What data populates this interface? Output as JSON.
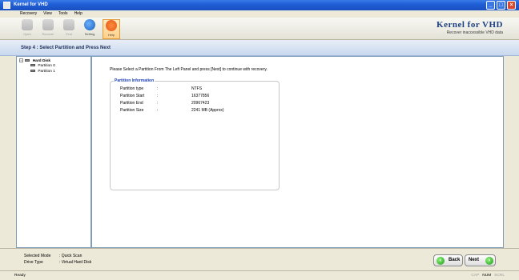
{
  "window": {
    "title": "Kernel for VHD",
    "buttons": [
      "_",
      "□",
      "×"
    ]
  },
  "menu": [
    "Recovery",
    "View",
    "Tools",
    "Help"
  ],
  "toolbar": {
    "items": [
      {
        "label": "Open",
        "enabled": false
      },
      {
        "label": "Recover",
        "enabled": false
      },
      {
        "label": "Find",
        "enabled": false
      },
      {
        "label": "Setting",
        "enabled": true
      },
      {
        "label": "Help",
        "enabled": true
      }
    ]
  },
  "brand": {
    "name": "Kernel for VHD",
    "tagline": "Recover inaccessible VHD data",
    "color": "#1d3f83"
  },
  "step": {
    "title": "Step 4 : Select Partition and Press Next"
  },
  "tree": {
    "root": "Hard Disk",
    "children": [
      "Partition 0",
      "Partition 1"
    ]
  },
  "main": {
    "instruction": "Please Select a Partition From The Left Panel and press [Next] to continue with recovery.",
    "info": {
      "legend": "Partition Information",
      "rows": [
        {
          "key": "Partition type",
          "sep": ":",
          "value": "NTFS"
        },
        {
          "key": "Partition Start",
          "sep": ":",
          "value": "16377856"
        },
        {
          "key": "Partition End",
          "sep": ":",
          "value": "20967423"
        },
        {
          "key": "Partition Size",
          "sep": ":",
          "value": "2241 MB (Approx)"
        }
      ]
    }
  },
  "bottom": {
    "mode": {
      "label": "Selected Mode",
      "value": ": Quick Scan"
    },
    "drive": {
      "label": "Drive Type",
      "value": ": Virtual Hard Disk"
    },
    "back_label": "Back",
    "next_label": "Next"
  },
  "status": {
    "ready": "Ready",
    "indicators": [
      {
        "label": "CAP",
        "active": false
      },
      {
        "label": "NUM",
        "active": true
      },
      {
        "label": "SCRL",
        "active": false
      }
    ]
  }
}
